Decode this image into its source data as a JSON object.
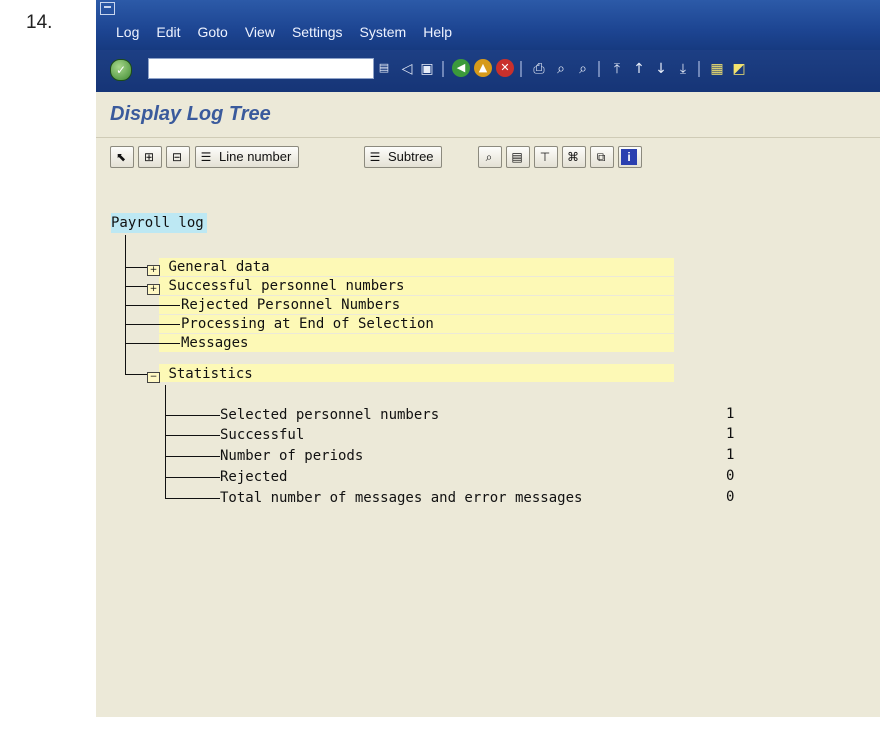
{
  "step_label": "14.",
  "menu": [
    "Log",
    "Edit",
    "Goto",
    "View",
    "Settings",
    "System",
    "Help"
  ],
  "command_field": {
    "value": ""
  },
  "screen_title": "Display Log Tree",
  "app_toolbar": {
    "line_number_label": "Line number",
    "subtree_label": "Subtree"
  },
  "log": {
    "root": "Payroll log",
    "nodes": [
      {
        "label": "General data",
        "folder": "+"
      },
      {
        "label": "Successful personnel numbers",
        "folder": "+"
      },
      {
        "label": "Rejected Personnel Numbers",
        "folder": ""
      },
      {
        "label": "Processing at End of Selection",
        "folder": ""
      },
      {
        "label": "Messages",
        "folder": ""
      },
      {
        "label": "Statistics",
        "folder": "−"
      }
    ],
    "statistics": [
      {
        "label": "Selected personnel numbers",
        "value": "1"
      },
      {
        "label": "Successful",
        "value": "1"
      },
      {
        "label": "Number of periods",
        "value": "1"
      },
      {
        "label": "Rejected",
        "value": "0"
      },
      {
        "label": "Total number of messages and error messages",
        "value": "0"
      }
    ]
  },
  "icons": {
    "enter": "check-icon",
    "back": "back-icon",
    "exit": "exit-icon",
    "cancel": "cancel-icon"
  },
  "colors": {
    "menubar": "#1d4592",
    "title": "#3a5a9c",
    "node_highlight": "#fdf9b6",
    "root_highlight": "#bde8f3",
    "background": "#ece9d8"
  }
}
